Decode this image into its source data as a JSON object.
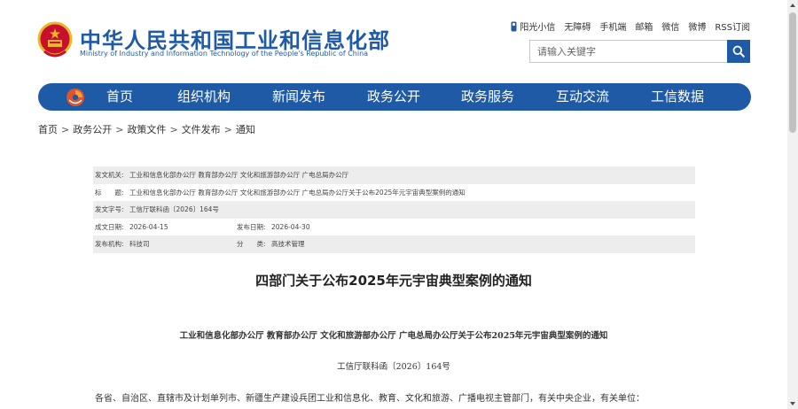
{
  "header": {
    "title_cn": "中华人民共和国工业和信息化部",
    "title_en": "Ministry of Industry and Information Technology of the People's Republic of China",
    "emblem_icon": "national-emblem-icon",
    "brand_color": "#1f5aa6"
  },
  "toplinks": {
    "items": [
      "阳光小信",
      "无障碍",
      "手机端",
      "邮箱",
      "微信",
      "微博",
      "RSS订阅"
    ]
  },
  "search": {
    "placeholder": "请输入关键字",
    "icon": "search-icon"
  },
  "nav": {
    "logo_icon": "miit-logo-icon",
    "items": [
      "首页",
      "组织机构",
      "新闻发布",
      "政务公开",
      "政务服务",
      "互动交流",
      "工信数据"
    ]
  },
  "breadcrumb": {
    "items": [
      "首页",
      "政务公开",
      "政策文件",
      "文件发布",
      "通知"
    ],
    "separator": ">"
  },
  "meta": {
    "issuer_label": "发文机关:",
    "issuer": "工业和信息化部办公厅 教育部办公厅 文化和旅游部办公厅 广电总局办公厅",
    "title_label": "标　　题:",
    "title": "工业和信息化部办公厅 教育部办公厅 文化和旅游部办公厅 广电总局办公厅关于公布2025年元宇宙典型案例的通知",
    "docno_label": "发文字号:",
    "docno": "工信厅联科函〔2026〕164号",
    "created_label": "成文日期:",
    "created": "2026-04-15",
    "published_label": "发布日期:",
    "published": "2026-04-30",
    "org_label": "发布机构:",
    "org": "科技司",
    "category_label": "分　　类:",
    "category": "高技术管理"
  },
  "article": {
    "title": "四部门关于公布2025年元宇宙典型案例的通知",
    "subtitle": "工业和信息化部办公厅  教育部办公厅  文化和旅游部办公厅  广电总局办公厅关于公布2025年元宇宙典型案例的通知",
    "docno": "工信厅联科函〔2026〕164号",
    "first_line": "各省、自治区、直辖市及计划单列市、新疆生产建设兵团工业和信息化、教育、文化和旅游、广播电视主管部门，有关中央企业，有关单位："
  }
}
